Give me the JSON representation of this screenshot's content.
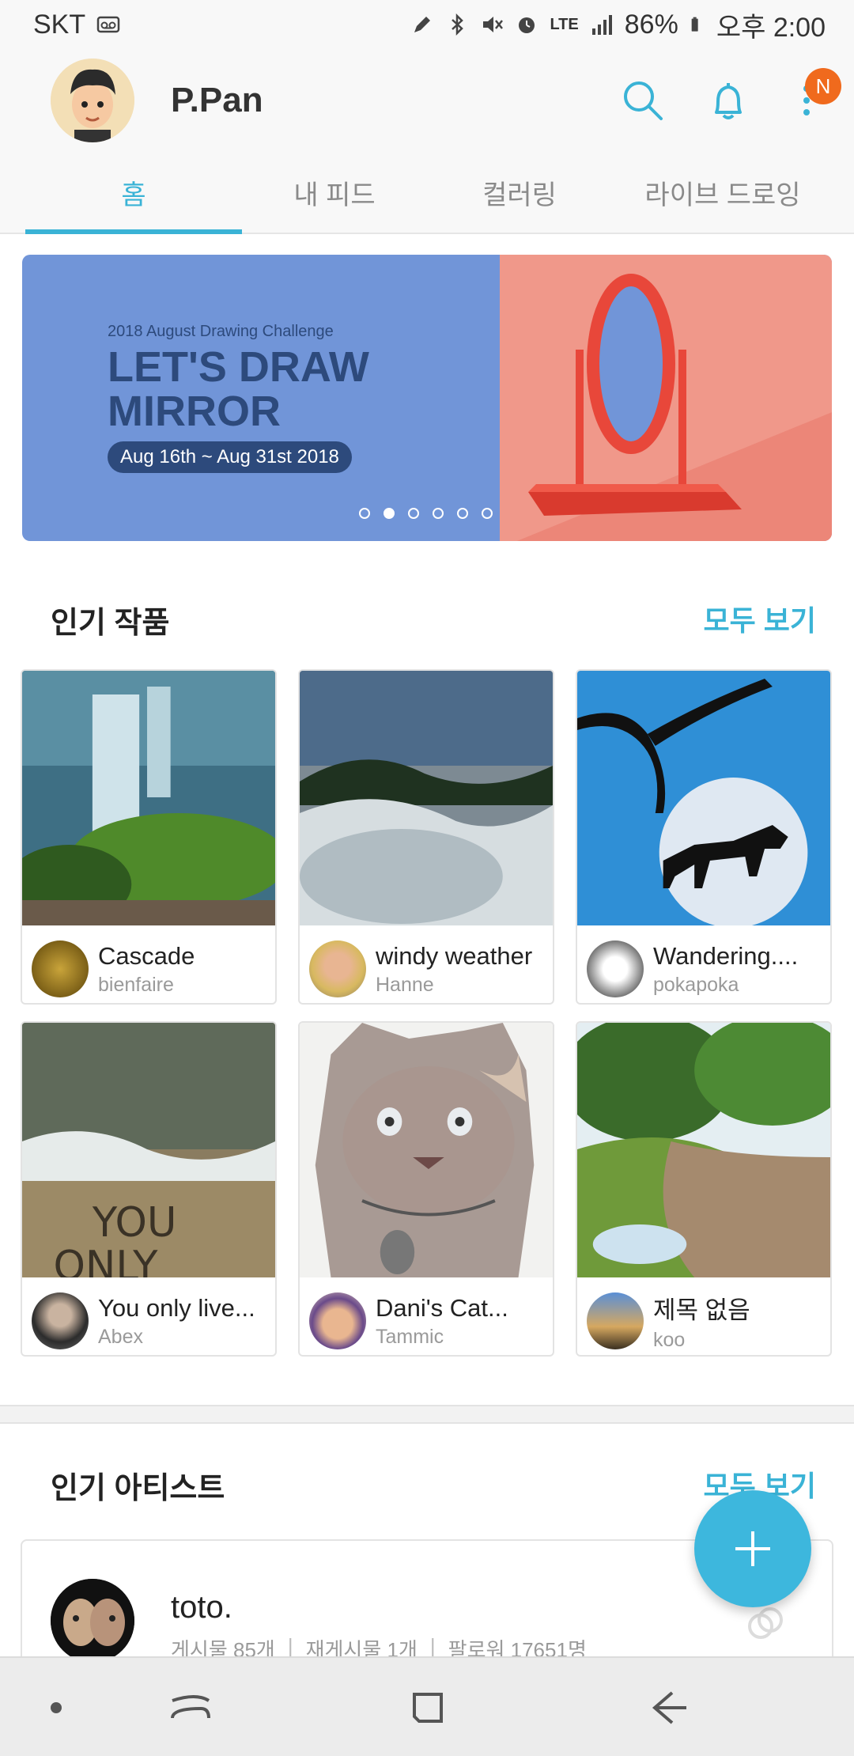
{
  "status_bar": {
    "carrier": "SKT",
    "battery": "86%",
    "time": "오후 2:00",
    "network": "LTE",
    "icons": [
      "voicemail-icon",
      "pen-icon",
      "bluetooth-icon",
      "mute-icon",
      "alarm-icon",
      "lte-icon",
      "signal-icon",
      "battery-icon"
    ]
  },
  "header": {
    "username": "P.Pan",
    "notification_badge": "N",
    "icons": [
      "search-icon",
      "bell-icon",
      "more-icon"
    ]
  },
  "tabs": [
    {
      "label": "홈",
      "active": true
    },
    {
      "label": "내 피드",
      "active": false
    },
    {
      "label": "컬러링",
      "active": false
    },
    {
      "label": "라이브 드로잉",
      "active": false
    }
  ],
  "banner": {
    "subtitle": "2018 August Drawing Challenge",
    "title": "LET'S DRAW MIRROR",
    "dates": "Aug 16th ~ Aug 31st 2018",
    "page_count": 6,
    "active_page": 2
  },
  "popular_works": {
    "title": "인기 작품",
    "see_all": "모두 보기",
    "items": [
      {
        "title": "Cascade",
        "author": "bienfaire"
      },
      {
        "title": "windy weather",
        "author": "Hanne"
      },
      {
        "title": "Wandering....",
        "author": "pokapoka"
      },
      {
        "title": "You only live...",
        "author": "Abex"
      },
      {
        "title": "Dani's Cat...",
        "author": "Tammic"
      },
      {
        "title": "제목 없음",
        "author": "koo"
      }
    ]
  },
  "popular_artists": {
    "title": "인기 아티스트",
    "see_all": "모두 보기",
    "items": [
      {
        "name": "toto.",
        "posts": "게시물 85개",
        "reposts": "재게시물 1개",
        "followers": "팔로워 17651명"
      }
    ]
  },
  "fab": {
    "icon": "plus-icon"
  },
  "nav": {
    "icons": [
      "recent-apps-dot-icon",
      "recents-icon",
      "home-icon",
      "back-icon"
    ]
  },
  "colors": {
    "accent": "#3ab3d6",
    "badge": "#f06a1d",
    "fab": "#3db7dd"
  }
}
